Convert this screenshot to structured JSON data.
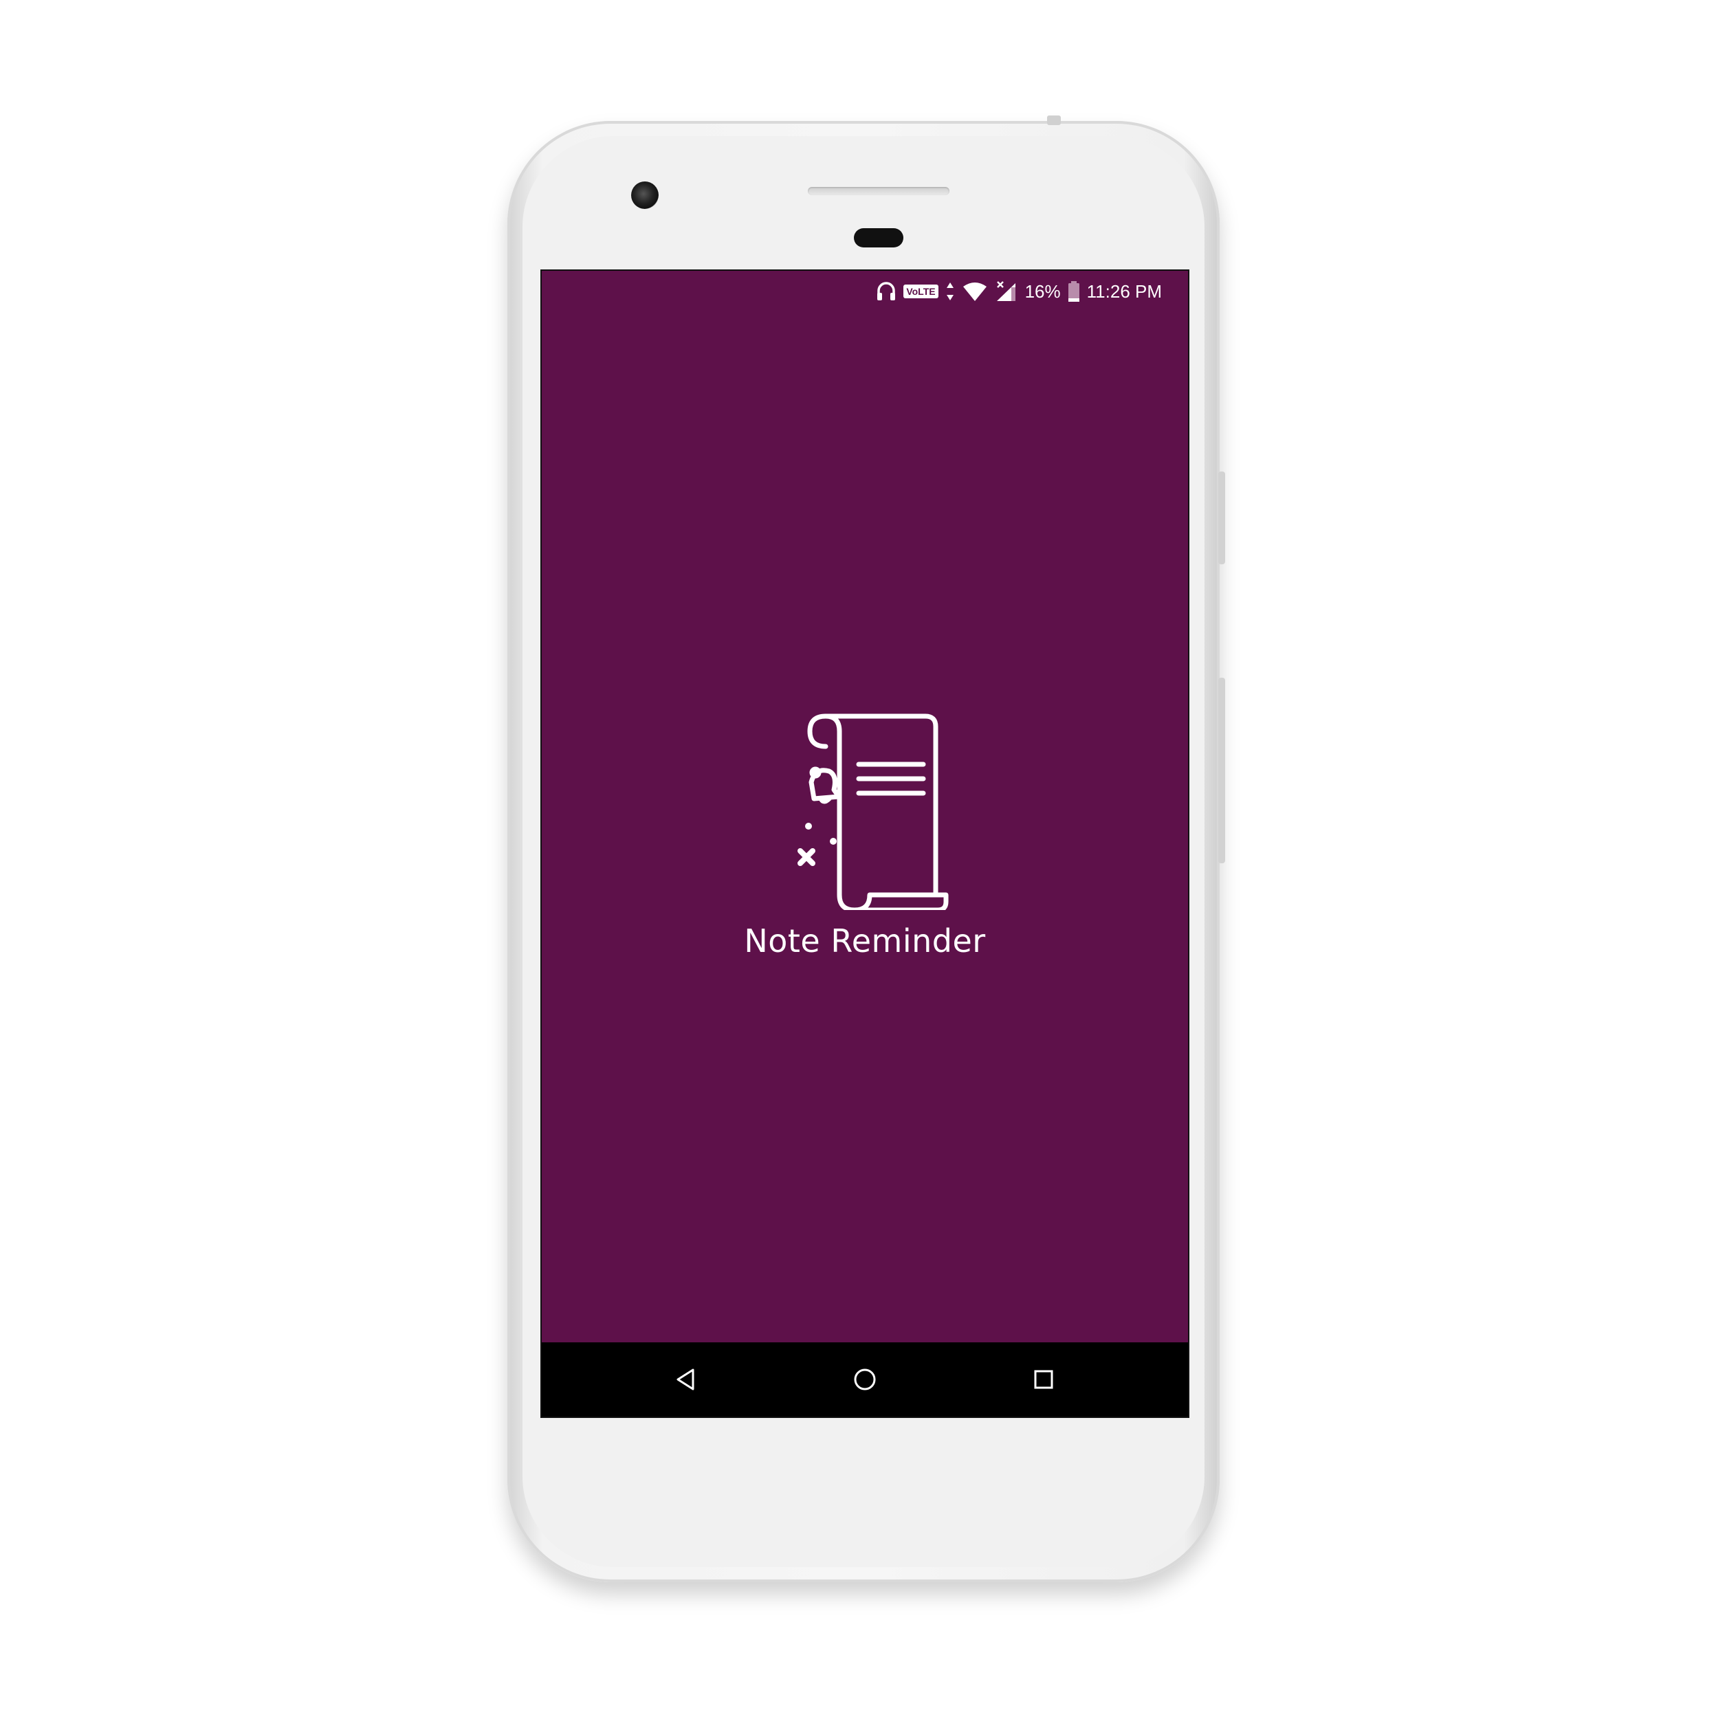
{
  "status_bar": {
    "volte_label": "VoLTE",
    "battery_percent": "16%",
    "time": "11:26 PM",
    "icons": [
      "headphones-icon",
      "data-arrows-icon",
      "wifi-icon",
      "signal-icon",
      "battery-icon"
    ]
  },
  "splash": {
    "app_name": "Note Reminder",
    "logo_icon": "scroll-note-with-bell-icon"
  },
  "navigation": {
    "back_icon": "back-triangle-icon",
    "home_icon": "home-circle-icon",
    "recents_icon": "recents-square-icon"
  },
  "colors": {
    "screen_background": "#5e114a",
    "nav_bar": "#000000",
    "foreground": "#ffffff",
    "device_body": "#f1f1f1"
  }
}
